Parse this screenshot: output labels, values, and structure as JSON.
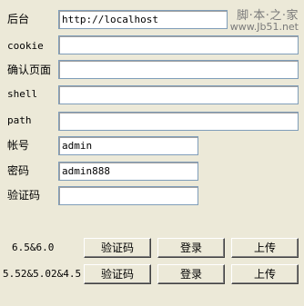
{
  "form": {
    "backend": {
      "label": "后台",
      "value": "http://localhost"
    },
    "cookie": {
      "label": "cookie",
      "value": ""
    },
    "confirm_page": {
      "label": "确认页面",
      "value": ""
    },
    "shell": {
      "label": "shell",
      "value": ""
    },
    "path": {
      "label": "path",
      "value": ""
    },
    "account": {
      "label": "帐号",
      "value": "admin"
    },
    "password": {
      "label": "密码",
      "value": "admin888"
    },
    "captcha": {
      "label": "验证码",
      "value": ""
    }
  },
  "actions": [
    {
      "version": "6.5&6.0",
      "captcha_button": "验证码",
      "login_button": "登录",
      "upload_button": "上传"
    },
    {
      "version": "5.52&5.02&4.5",
      "captcha_button": "验证码",
      "login_button": "登录",
      "upload_button": "上传"
    }
  ],
  "watermark": {
    "line1": "脚·本·之·家",
    "line2": "www.Jb51.net"
  }
}
